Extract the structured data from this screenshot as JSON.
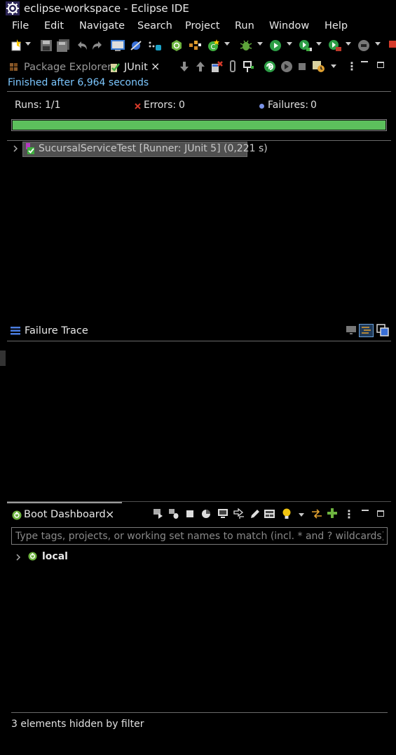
{
  "window": {
    "title": "eclipse-workspace - Eclipse IDE"
  },
  "menu": [
    "File",
    "Edit",
    "Navigate",
    "Search",
    "Project",
    "Run",
    "Window",
    "Help"
  ],
  "tabs": {
    "package_explorer": "Package Explorer",
    "junit": "JUnit"
  },
  "junit": {
    "status": "Finished after 6,964 seconds",
    "runs_label": "Runs:",
    "runs_value": "1/1",
    "errors_label": "Errors:",
    "errors_value": "0",
    "failures_label": "Failures:",
    "failures_value": "0",
    "progress_fraction": 1.0,
    "progress_color": "#5cbf5c",
    "test_item": "SucursalServiceTest [Runner: JUnit 5] (0,221 s)"
  },
  "failure_trace": {
    "title": "Failure Trace"
  },
  "boot_dashboard": {
    "title": "Boot Dashboard",
    "filter_placeholder": "Type tags, projects, or working set names to match (incl. * and ? wildcards)",
    "local_label": "local",
    "hidden_message": "3 elements hidden by filter"
  },
  "colors": {
    "status_text": "#7cc7ff",
    "success": "#5cbf5c",
    "background": "#000000"
  }
}
